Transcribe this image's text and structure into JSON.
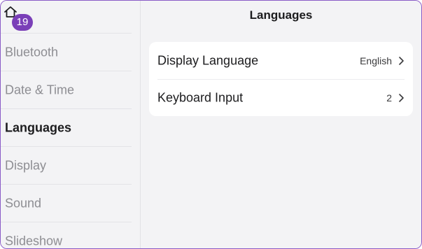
{
  "badge": "19",
  "sidebar": {
    "items": [
      {
        "label": "Bluetooth"
      },
      {
        "label": "Date & Time"
      },
      {
        "label": "Languages"
      },
      {
        "label": "Display"
      },
      {
        "label": "Sound"
      },
      {
        "label": "Slideshow"
      }
    ]
  },
  "header": {
    "title": "Languages"
  },
  "rows": [
    {
      "label": "Display Language",
      "value": "English"
    },
    {
      "label": "Keyboard Input",
      "value": "2"
    }
  ],
  "colors": {
    "accent": "#7a3fb8",
    "border": "#8a5bc7"
  }
}
